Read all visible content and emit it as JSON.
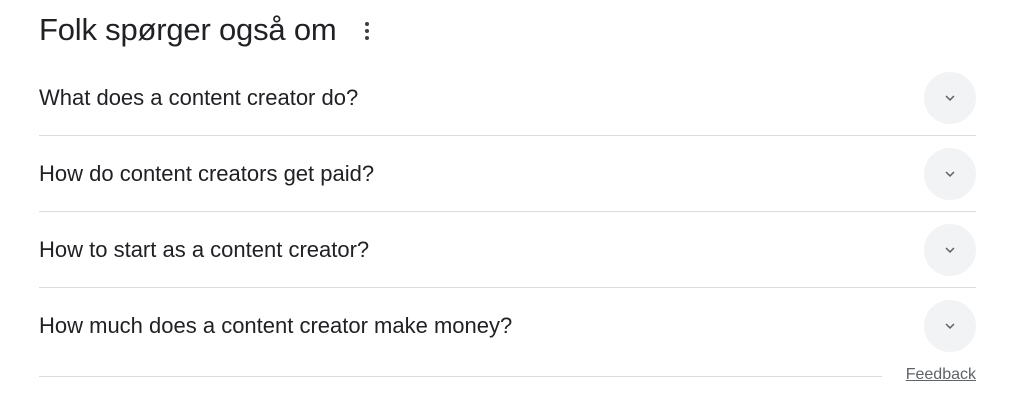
{
  "header": {
    "title": "Folk spørger også om",
    "menu_icon": "more-vert-icon"
  },
  "questions": [
    {
      "text": "What does a content creator do?",
      "icon": "chevron-down-icon"
    },
    {
      "text": "How do content creators get paid?",
      "icon": "chevron-down-icon"
    },
    {
      "text": "How to start as a content creator?",
      "icon": "chevron-down-icon"
    },
    {
      "text": "How much does a content creator make money?",
      "icon": "chevron-down-icon"
    }
  ],
  "footer": {
    "feedback_label": "Feedback"
  },
  "colors": {
    "text": "#202124",
    "divider": "#dadce0",
    "button_bg": "#f1f3f4",
    "secondary_text": "#5f6368"
  }
}
